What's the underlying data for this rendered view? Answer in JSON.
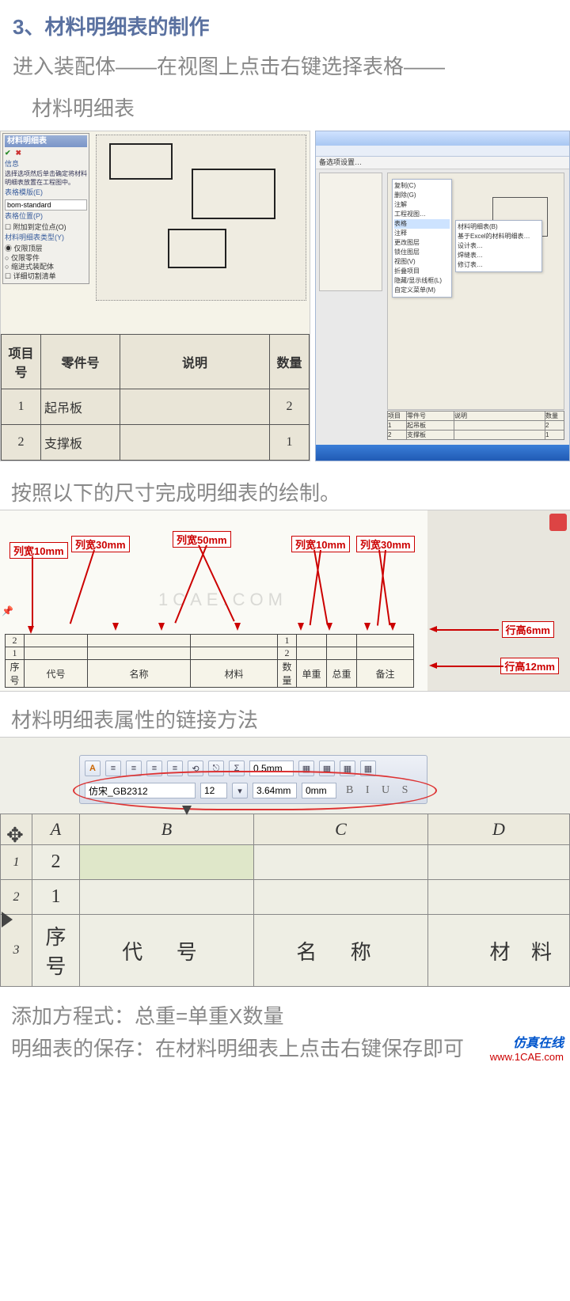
{
  "heading": "3、材料明细表的制作",
  "intro_line1": "进入装配体——在视图上点击右键选择表格——",
  "intro_line2": "材料明细表",
  "left_panel": {
    "title": "材料明细表",
    "info_label": "信息",
    "info_text": "选择选项然后单击确定将材料明细表放置在工程图中。",
    "template_label": "表格模版(E)",
    "template_value": "bom-standard",
    "position_label": "表格位置(P)",
    "position_check": "附加到定位点(O)",
    "type_label": "材料明细表类型(Y)",
    "opt1": "仅限顶层",
    "opt2": "仅限零件",
    "opt3": "缩进式装配体",
    "opt4": "详细切割清单"
  },
  "bom_table": {
    "headers": [
      "项目号",
      "零件号",
      "说明",
      "数量"
    ],
    "rows": [
      [
        "1",
        "起吊板",
        "",
        "2"
      ],
      [
        "2",
        "支撑板",
        "",
        "1"
      ]
    ]
  },
  "right_img": {
    "toolbar_hint": "备选项设置…",
    "context_menu_items": [
      "复制(C)",
      "删除(G)",
      "注解",
      "工程视图…",
      "表格",
      "注释",
      "更改图层",
      "锁住图层",
      "视图(V)",
      "折叠项目",
      "隐藏/显示线框(L)",
      "自定义菜单(M)"
    ],
    "submenu_items": [
      "材料明细表(B)",
      "基于Excel的材料明细表…",
      "设计表…",
      "焊缝表…",
      "修订表…"
    ],
    "mini_headers": [
      "项目",
      "零件号",
      "说明",
      "数量"
    ],
    "mini_rows": [
      [
        "1",
        "起吊板",
        "",
        "2"
      ],
      [
        "2",
        "支撑板",
        "",
        "1"
      ]
    ]
  },
  "sub1": "按照以下的尺寸完成明细表的绘制。",
  "dim_labels": {
    "w10a": "列宽10mm",
    "w30a": "列宽30mm",
    "w50": "列宽50mm",
    "w10b": "列宽10mm",
    "w30b": "列宽30mm",
    "h6": "行高6mm",
    "h12": "行高12mm"
  },
  "dim_table": {
    "row3": [
      "序号",
      "代号",
      "名称",
      "材料",
      "数量",
      "单重",
      "总重",
      "备注"
    ],
    "row1": [
      "2",
      "",
      "",
      "",
      "1",
      "",
      "",
      ""
    ],
    "row2": [
      "1",
      "",
      "",
      "",
      "2",
      "",
      "",
      ""
    ]
  },
  "sub2": "材料明细表属性的链接方法",
  "toolbar": {
    "value_box": "0.5mm",
    "font_name": "仿宋_GB2312",
    "font_size": "12",
    "line_sp": "3.64mm",
    "indent": "0mm",
    "biu": "B  I  U  S"
  },
  "sheet": {
    "cols": [
      "",
      "A",
      "B",
      "C",
      "D"
    ],
    "rows": [
      {
        "num": "1",
        "A": "2",
        "B": "",
        "C": "",
        "D": ""
      },
      {
        "num": "2",
        "A": "1",
        "B": "",
        "C": "",
        "D": ""
      },
      {
        "num": "3",
        "A": "序号",
        "B": "代        号",
        "C": "名        称",
        "D": "材    料"
      }
    ]
  },
  "footer1": "添加方程式：总重=单重X数量",
  "footer2": "明细表的保存：在材料明细表上点击右键保存即可",
  "brand1": "仿真在线",
  "brand2": "www.1CAE.com",
  "watermark": "1CAE.COM"
}
